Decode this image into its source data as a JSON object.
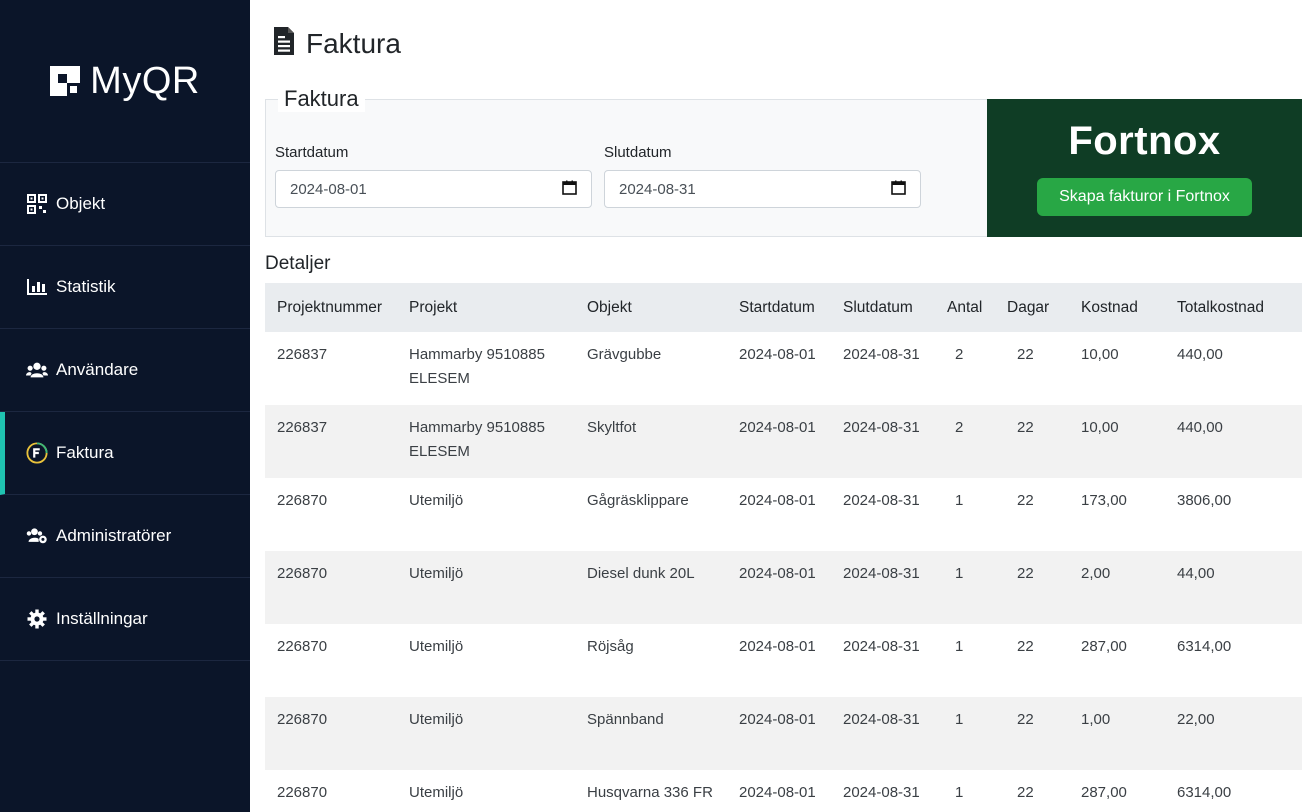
{
  "brand": {
    "name": "MyQR"
  },
  "sidebar": {
    "items": [
      {
        "label": "Objekt",
        "icon": "qr-grid-icon"
      },
      {
        "label": "Statistik",
        "icon": "bar-chart-icon"
      },
      {
        "label": "Användare",
        "icon": "users-icon"
      },
      {
        "label": "Faktura",
        "icon": "fortnox-f-icon",
        "active": true
      },
      {
        "label": "Administratörer",
        "icon": "users-cog-icon"
      },
      {
        "label": "Inställningar",
        "icon": "gear-icon"
      }
    ]
  },
  "header": {
    "title": "Faktura",
    "icon": "invoice-icon"
  },
  "filter": {
    "legend": "Faktura",
    "start_label": "Startdatum",
    "start_value": "2024-08-01",
    "end_label": "Slutdatum",
    "end_value": "2024-08-31"
  },
  "fortnox": {
    "logo_text": "Fortnox",
    "button_label": "Skapa fakturor i Fortnox",
    "bg_color": "#0f3d25",
    "button_color": "#28a745"
  },
  "details": {
    "label": "Detaljer",
    "columns": [
      "Projektnummer",
      "Projekt",
      "Objekt",
      "Startdatum",
      "Slutdatum",
      "Antal",
      "Dagar",
      "Kostnad",
      "Totalkostnad"
    ],
    "rows": [
      {
        "projektnummer": "226837",
        "projekt": "Hammarby 9510885 ELESEM",
        "objekt": "Grävgubbe",
        "startdatum": "2024-08-01",
        "slutdatum": "2024-08-31",
        "antal": "2",
        "dagar": "22",
        "kostnad": "10,00",
        "totalkostnad": "440,00"
      },
      {
        "projektnummer": "226837",
        "projekt": "Hammarby 9510885 ELESEM",
        "objekt": "Skyltfot",
        "startdatum": "2024-08-01",
        "slutdatum": "2024-08-31",
        "antal": "2",
        "dagar": "22",
        "kostnad": "10,00",
        "totalkostnad": "440,00"
      },
      {
        "projektnummer": "226870",
        "projekt": "Utemiljö",
        "objekt": "Gågräsklippare",
        "startdatum": "2024-08-01",
        "slutdatum": "2024-08-31",
        "antal": "1",
        "dagar": "22",
        "kostnad": "173,00",
        "totalkostnad": "3806,00"
      },
      {
        "projektnummer": "226870",
        "projekt": "Utemiljö",
        "objekt": "Diesel dunk 20L",
        "startdatum": "2024-08-01",
        "slutdatum": "2024-08-31",
        "antal": "1",
        "dagar": "22",
        "kostnad": "2,00",
        "totalkostnad": "44,00"
      },
      {
        "projektnummer": "226870",
        "projekt": "Utemiljö",
        "objekt": "Röjsåg",
        "startdatum": "2024-08-01",
        "slutdatum": "2024-08-31",
        "antal": "1",
        "dagar": "22",
        "kostnad": "287,00",
        "totalkostnad": "6314,00"
      },
      {
        "projektnummer": "226870",
        "projekt": "Utemiljö",
        "objekt": "Spännband",
        "startdatum": "2024-08-01",
        "slutdatum": "2024-08-31",
        "antal": "1",
        "dagar": "22",
        "kostnad": "1,00",
        "totalkostnad": "22,00"
      },
      {
        "projektnummer": "226870",
        "projekt": "Utemiljö",
        "objekt": "Husqvarna 336 FR",
        "startdatum": "2024-08-01",
        "slutdatum": "2024-08-31",
        "antal": "1",
        "dagar": "22",
        "kostnad": "287,00",
        "totalkostnad": "6314,00"
      }
    ]
  },
  "colors": {
    "sidebar_bg": "#0b1529",
    "active_accent": "#1fc3b0"
  }
}
